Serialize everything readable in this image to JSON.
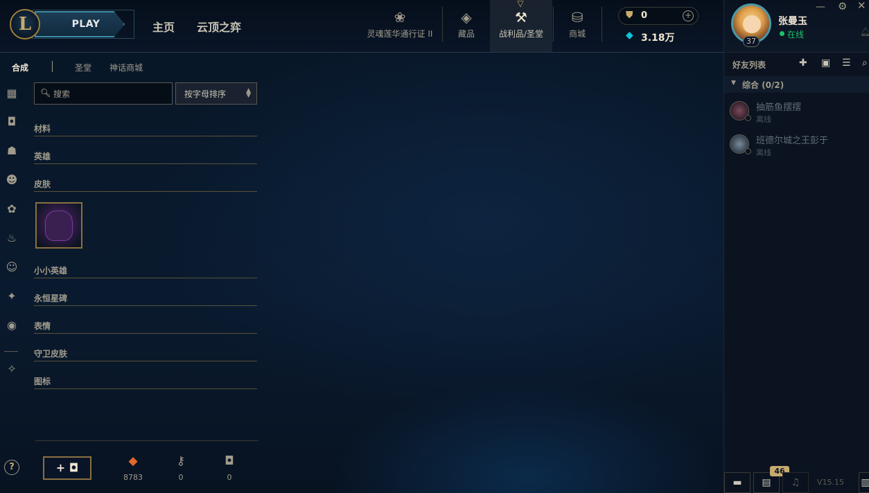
{
  "topbar": {
    "play_label": "PLAY",
    "nav": [
      "主页",
      "云顶之弈"
    ],
    "icon_items": [
      {
        "label": "灵魂莲华通行证 II",
        "icon": "lotus-icon"
      },
      {
        "label": "藏品",
        "icon": "backpack-icon"
      },
      {
        "label": "战利品/圣堂",
        "icon": "hammer-icon"
      },
      {
        "label": "商城",
        "icon": "coins-icon"
      }
    ],
    "rp_value": "0",
    "be_value": "3.18万"
  },
  "profile": {
    "name": "张曼玉",
    "status": "在线",
    "level": "37"
  },
  "friends": {
    "title": "好友列表",
    "group_label": "综合 (0/2)",
    "list": [
      {
        "name": "抽筋鱼摆摆",
        "status": "离线"
      },
      {
        "name": "班德尔城之王彭于",
        "status": "离线"
      }
    ]
  },
  "bottom_right": {
    "badge": "46",
    "version": "V15.15"
  },
  "subtabs": [
    "合成",
    "圣堂",
    "神话商城"
  ],
  "search": {
    "placeholder": "搜索"
  },
  "sort": {
    "label": "按字母排序"
  },
  "categories": [
    "材料",
    "英雄",
    "皮肤",
    "小小英雄",
    "永恒星碑",
    "表情",
    "守卫皮肤",
    "图标"
  ],
  "bottom_bar": {
    "add_label": "+",
    "currencies": [
      {
        "icon": "orange-essence-icon",
        "value": "8783"
      },
      {
        "icon": "key-icon",
        "value": "0"
      },
      {
        "icon": "chest-icon",
        "value": "0"
      }
    ]
  }
}
